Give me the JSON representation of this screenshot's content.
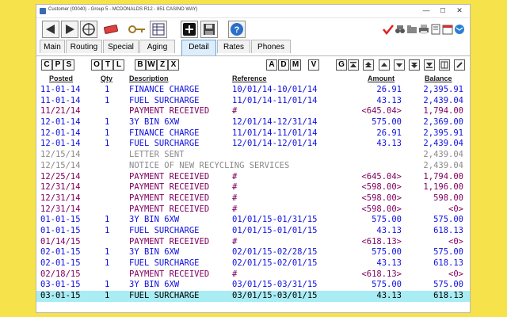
{
  "window": {
    "title": "Customer (00040) - Group 5 - MCDONALDS R12 - 851 CASINO WAY)"
  },
  "window_controls": {
    "minimize": "—",
    "maximize": "☐",
    "close": "✕"
  },
  "toolbar": {
    "buttons": [
      "back-arrow-icon",
      "forward-arrow-icon",
      "crosshair-icon",
      "eraser-icon",
      "key-icon",
      "table-icon",
      "add-icon",
      "save-icon",
      "help-icon"
    ],
    "right_icons": [
      "check-icon",
      "binoculars-icon",
      "folder-icon",
      "printer-icon",
      "document-icon",
      "calendar-icon",
      "mail-icon"
    ]
  },
  "tabs": [
    {
      "label": "Main",
      "active": false
    },
    {
      "label": "Routing",
      "active": false
    },
    {
      "label": "Special",
      "active": false
    },
    {
      "label": "Aging",
      "active": false
    },
    {
      "label": "Detail",
      "active": true
    },
    {
      "label": "Rates",
      "active": false
    },
    {
      "label": "Phones",
      "active": false
    }
  ],
  "letter_buttons": {
    "group1": [
      "C",
      "P",
      "S"
    ],
    "group2": [
      "O",
      "T",
      "L",
      "B",
      "W",
      "Z",
      "X"
    ],
    "group3": [
      "A",
      "D",
      "M",
      "V"
    ],
    "group4": [
      "G"
    ]
  },
  "colors": {
    "blue": "#1010e0",
    "purple": "#800060",
    "gray": "#8a8a8a",
    "black": "#000000",
    "selected_row": "#a8ecf4"
  },
  "columns": {
    "posted": "Posted",
    "qty": "Qty",
    "description": "Description",
    "reference": "Reference",
    "amount": "Amount",
    "balance": "Balance"
  },
  "rows": [
    {
      "posted": "11-01-14",
      "qty": "1",
      "description": "FINANCE CHARGE",
      "reference": "10/01/14-10/01/14",
      "amount": "26.91",
      "balance": "2,395.91",
      "color": "blue"
    },
    {
      "posted": "11-01-14",
      "qty": "1",
      "description": "FUEL SURCHARGE",
      "reference": "11/01/14-11/01/14",
      "amount": "43.13",
      "balance": "2,439.04",
      "color": "blue"
    },
    {
      "posted": "11/21/14",
      "qty": "",
      "description": "PAYMENT RECEIVED",
      "reference": "#",
      "amount": "<645.04>",
      "balance": "1,794.00",
      "color": "purple"
    },
    {
      "posted": "12-01-14",
      "qty": "1",
      "description": "3Y BIN 6XW",
      "reference": "12/01/14-12/31/14",
      "amount": "575.00",
      "balance": "2,369.00",
      "color": "blue"
    },
    {
      "posted": "12-01-14",
      "qty": "1",
      "description": "FINANCE CHARGE",
      "reference": "11/01/14-11/01/14",
      "amount": "26.91",
      "balance": "2,395.91",
      "color": "blue"
    },
    {
      "posted": "12-01-14",
      "qty": "1",
      "description": "FUEL SURCHARGE",
      "reference": "12/01/14-12/01/14",
      "amount": "43.13",
      "balance": "2,439.04",
      "color": "blue"
    },
    {
      "posted": "12/15/14",
      "qty": "",
      "description": "LETTER SENT",
      "reference": "",
      "amount": "",
      "balance": "2,439.04",
      "color": "gray"
    },
    {
      "posted": "12/15/14",
      "qty": "",
      "description": "NOTICE OF NEW RECYCLING SERVICES",
      "reference": "",
      "amount": "",
      "balance": "2,439.04",
      "color": "gray"
    },
    {
      "posted": "12/25/14",
      "qty": "",
      "description": "PAYMENT RECEIVED",
      "reference": "#",
      "amount": "<645.04>",
      "balance": "1,794.00",
      "color": "purple"
    },
    {
      "posted": "12/31/14",
      "qty": "",
      "description": "PAYMENT RECEIVED",
      "reference": "#",
      "amount": "<598.00>",
      "balance": "1,196.00",
      "color": "purple"
    },
    {
      "posted": "12/31/14",
      "qty": "",
      "description": "PAYMENT RECEIVED",
      "reference": "#",
      "amount": "<598.00>",
      "balance": "598.00",
      "color": "purple"
    },
    {
      "posted": "12/31/14",
      "qty": "",
      "description": "PAYMENT RECEIVED",
      "reference": "#",
      "amount": "<598.00>",
      "balance": "<0>",
      "color": "purple"
    },
    {
      "posted": "01-01-15",
      "qty": "1",
      "description": "3Y BIN 6XW",
      "reference": "01/01/15-01/31/15",
      "amount": "575.00",
      "balance": "575.00",
      "color": "blue"
    },
    {
      "posted": "01-01-15",
      "qty": "1",
      "description": "FUEL SURCHARGE",
      "reference": "01/01/15-01/01/15",
      "amount": "43.13",
      "balance": "618.13",
      "color": "blue"
    },
    {
      "posted": "01/14/15",
      "qty": "",
      "description": "PAYMENT RECEIVED",
      "reference": "#",
      "amount": "<618.13>",
      "balance": "<0>",
      "color": "purple"
    },
    {
      "posted": "02-01-15",
      "qty": "1",
      "description": "3Y BIN 6XW",
      "reference": "02/01/15-02/28/15",
      "amount": "575.00",
      "balance": "575.00",
      "color": "blue"
    },
    {
      "posted": "02-01-15",
      "qty": "1",
      "description": "FUEL SURCHARGE",
      "reference": "02/01/15-02/01/15",
      "amount": "43.13",
      "balance": "618.13",
      "color": "blue"
    },
    {
      "posted": "02/18/15",
      "qty": "",
      "description": "PAYMENT RECEIVED",
      "reference": "#",
      "amount": "<618.13>",
      "balance": "<0>",
      "color": "purple"
    },
    {
      "posted": "03-01-15",
      "qty": "1",
      "description": "3Y BIN 6XW",
      "reference": "03/01/15-03/31/15",
      "amount": "575.00",
      "balance": "575.00",
      "color": "blue"
    },
    {
      "posted": "03-01-15",
      "qty": "1",
      "description": "FUEL SURCHARGE",
      "reference": "03/01/15-03/01/15",
      "amount": "43.13",
      "balance": "618.13",
      "color": "black",
      "selected": true
    }
  ]
}
